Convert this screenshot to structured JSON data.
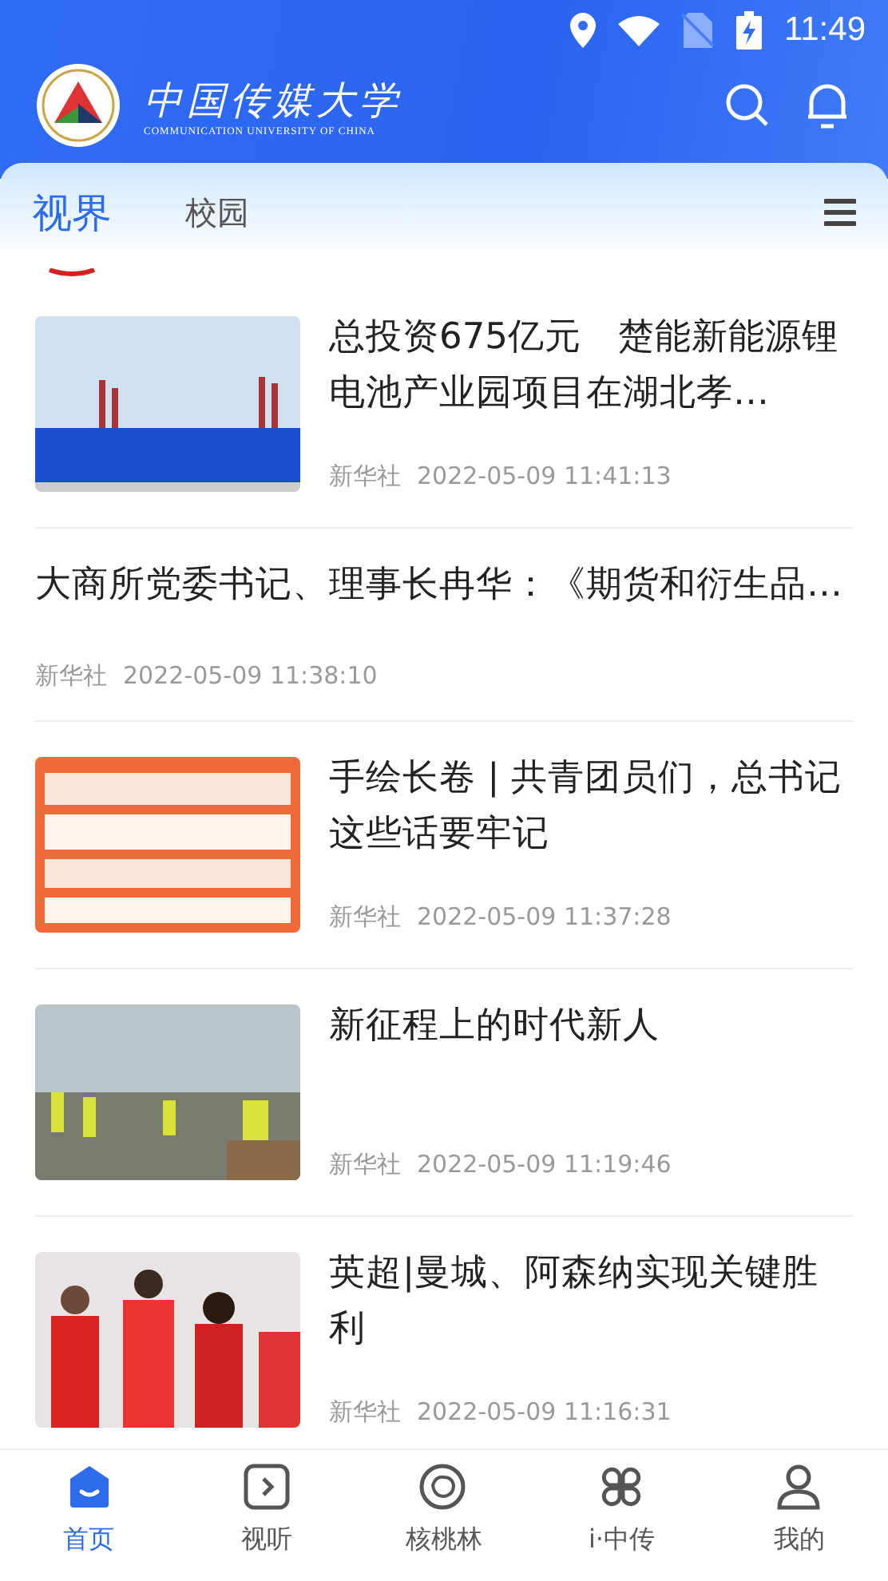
{
  "status_bar": {
    "time": "11:49"
  },
  "header": {
    "logo_title": "中国传媒大学",
    "logo_subtitle": "COMMUNICATION UNIVERSITY OF CHINA"
  },
  "tabs": [
    {
      "label": "视界",
      "selected": true
    },
    {
      "label": "校园",
      "selected": false
    }
  ],
  "news": [
    {
      "kind": "thumb",
      "title": "总投资675亿元　楚能新能源锂电池产业园项目在湖北孝…",
      "source": "新华社",
      "time": "2022-05-09 11:41:13"
    },
    {
      "kind": "text",
      "title": "大商所党委书记、理事长冉华：《期货和衍生品…",
      "source": "新华社",
      "time": "2022-05-09 11:38:10"
    },
    {
      "kind": "thumb",
      "title": "手绘长卷 | 共青团员们，总书记这些话要牢记",
      "source": "新华社",
      "time": "2022-05-09 11:37:28"
    },
    {
      "kind": "thumb",
      "title": "新征程上的时代新人",
      "source": "新华社",
      "time": "2022-05-09 11:19:46"
    },
    {
      "kind": "thumb",
      "title": "英超|曼城、阿森纳实现关键胜利",
      "source": "新华社",
      "time": "2022-05-09 11:16:31"
    }
  ],
  "bottom_nav": [
    {
      "label": "首页",
      "selected": true
    },
    {
      "label": "视听",
      "selected": false
    },
    {
      "label": "核桃林",
      "selected": false
    },
    {
      "label": "i·中传",
      "selected": false
    },
    {
      "label": "我的",
      "selected": false
    }
  ]
}
